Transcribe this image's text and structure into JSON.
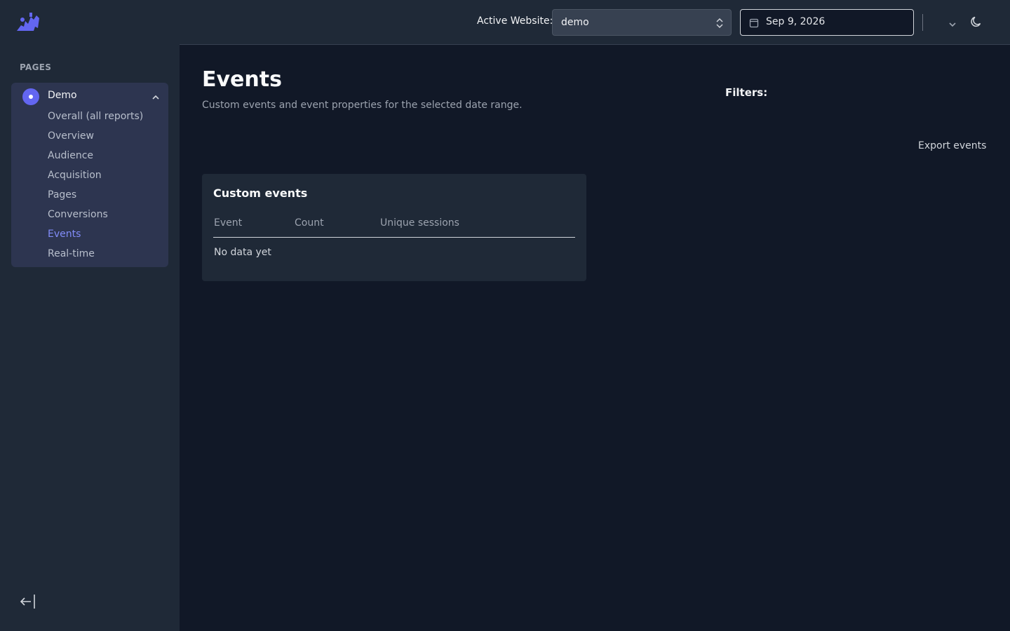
{
  "sidebar": {
    "section_label": "PAGES",
    "group": {
      "title": "Demo",
      "items": [
        {
          "label": "Overall (all reports)"
        },
        {
          "label": "Overview"
        },
        {
          "label": "Audience"
        },
        {
          "label": "Acquisition"
        },
        {
          "label": "Pages"
        },
        {
          "label": "Conversions"
        },
        {
          "label": "Events",
          "active": true
        },
        {
          "label": "Real-time"
        }
      ]
    }
  },
  "topbar": {
    "active_label": "Active Website:",
    "site_value": "demo",
    "date_value": "Sep 9, 2026"
  },
  "main": {
    "title": "Events",
    "subtitle": "Custom events and event properties for the selected date range.",
    "filters_label": "Filters:",
    "export_label": "Export events",
    "card": {
      "title": "Custom events",
      "columns": [
        "Event",
        "Count",
        "Unique sessions"
      ],
      "empty_text": "No data yet"
    }
  },
  "colors": {
    "accent": "#6366f1",
    "active_nav": "#818cf8",
    "background": "#111827",
    "panel": "#1f2937"
  },
  "icons": {
    "logo": "app-logo-icon",
    "site": "site-avatar-icon",
    "collapse_group": "chevron-up-icon",
    "select": "select-arrows-icon",
    "date": "calendar-icon",
    "user_menu": "chevron-down-icon",
    "theme": "moon-icon",
    "collapse_sidebar": "collapse-sidebar-icon"
  }
}
